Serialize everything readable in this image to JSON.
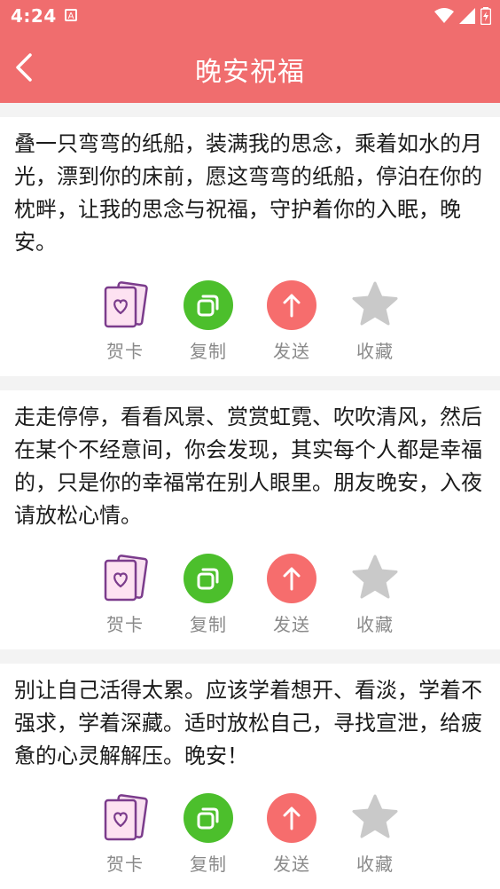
{
  "status": {
    "time": "4:24",
    "notification_glyph": "A"
  },
  "appbar": {
    "title": "晚安祝福"
  },
  "colors": {
    "primary": "#f06d6e",
    "copy": "#4cbf2c",
    "send": "#f66d6d",
    "star": "#c9c9c9",
    "card_icon": "#7b3c8c"
  },
  "posts": [
    {
      "text": "叠一只弯弯的纸船，装满我的思念，乘着如水的月光，漂到你的床前，愿这弯弯的纸船，停泊在你的枕畔，让我的思念与祝福，守护着你的入眠，晚安。",
      "actions": [
        {
          "label": "贺卡",
          "icon": "greeting-card-icon"
        },
        {
          "label": "复制",
          "icon": "copy-icon"
        },
        {
          "label": "发送",
          "icon": "send-icon"
        },
        {
          "label": "收藏",
          "icon": "star-icon"
        }
      ]
    },
    {
      "text": "走走停停，看看风景、赏赏虹霓、吹吹清风，然后在某个不经意间，你会发现，其实每个人都是幸福的，只是你的幸福常在别人眼里。朋友晚安，入夜请放松心情。",
      "actions": [
        {
          "label": "贺卡",
          "icon": "greeting-card-icon"
        },
        {
          "label": "复制",
          "icon": "copy-icon"
        },
        {
          "label": "发送",
          "icon": "send-icon"
        },
        {
          "label": "收藏",
          "icon": "star-icon"
        }
      ]
    },
    {
      "text": "别让自己活得太累。应该学着想开、看淡，学着不强求，学着深藏。适时放松自己，寻找宣泄，给疲惫的心灵解解压。晚安！",
      "actions": [
        {
          "label": "贺卡",
          "icon": "greeting-card-icon"
        },
        {
          "label": "复制",
          "icon": "copy-icon"
        },
        {
          "label": "发送",
          "icon": "send-icon"
        },
        {
          "label": "收藏",
          "icon": "star-icon"
        }
      ]
    }
  ]
}
